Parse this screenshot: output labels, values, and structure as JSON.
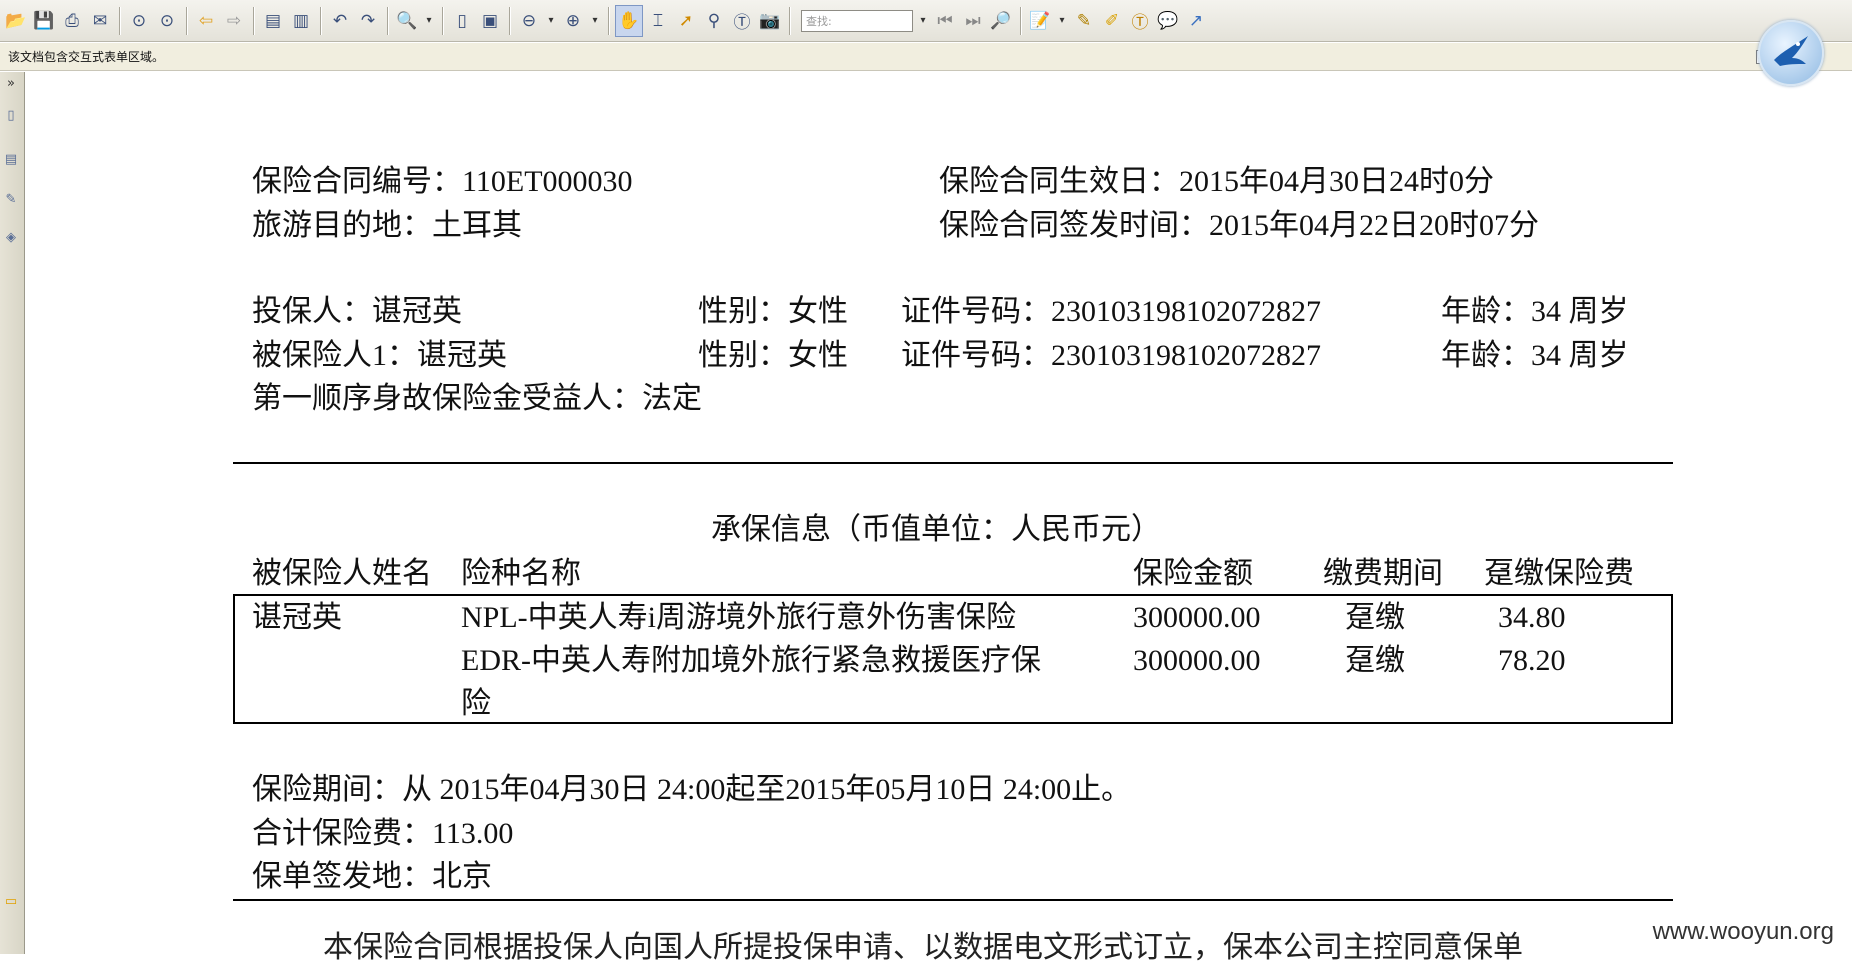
{
  "toolbar": {
    "search_placeholder": "查找:",
    "buttons": [
      "open-folder-icon",
      "save-icon",
      "print-icon",
      "email-icon",
      "prev-page-icon",
      "next-page-icon",
      "back-icon",
      "forward-icon",
      "page-layout-icon",
      "two-page-icon",
      "undo-icon",
      "redo-icon",
      "zoom-in-icon",
      "fit-page-icon",
      "fit-width-icon",
      "zoom-out-icon",
      "zoom-plus-icon",
      "hand-tool-icon",
      "select-text-icon",
      "select-arrow-icon",
      "binoculars-icon",
      "text-select-icon",
      "snapshot-icon",
      "search-prev-icon",
      "search-next-icon",
      "search-options-icon",
      "comment-icon",
      "annotate-icon",
      "highlight-icon",
      "text-box-icon",
      "note-icon",
      "arrow-tool-icon"
    ]
  },
  "infobar": {
    "message": "该文档包含交互式表单区域。"
  },
  "document": {
    "contract_no": "保险合同编号：110ET000030",
    "effective_date": "保险合同生效日：2015年04月30日24时0分",
    "destination": "旅游目的地：土耳其",
    "issue_time": "保险合同签发时间：2015年04月22日20时07分",
    "policyholder": {
      "name": "投保人：谌冠英",
      "gender": "性别：女性",
      "id_no": "证件号码：230103198102072827",
      "age": "年龄：34 周岁"
    },
    "insured": {
      "name": "被保险人1：谌冠英",
      "gender": "性别：女性",
      "id_no": "证件号码：230103198102072827",
      "age": "年龄：34 周岁"
    },
    "beneficiary": "第一顺序身故保险金受益人：法定",
    "coverage_title": "承保信息（币值单位：人民币元）",
    "table_headers": [
      "被保险人姓名",
      "险种名称",
      "保险金额",
      "缴费期间",
      "趸缴保险费"
    ],
    "insured_name_cell": "谌冠英",
    "rows": [
      {
        "product": "NPL-中英人寿i周游境外旅行意外伤害保险",
        "amount": "300000.00",
        "period": "趸缴",
        "premium": "34.80"
      },
      {
        "product": "EDR-中英人寿附加境外旅行紧急救援医疗保",
        "product_cont": "险",
        "amount": "300000.00",
        "period": "趸缴",
        "premium": "78.20"
      }
    ],
    "insurance_period": "保险期间：从 2015年04月30日 24:00起至2015年05月10日 24:00止。",
    "total_premium": "合计保险费：113.00",
    "issue_place": "保单签发地：北京",
    "cut_line": "本保险合同根据投保人向国人所提投保申请、以数据电文形式订立，保本公司主控同意保单"
  },
  "watermark": "www.wooyun.org"
}
